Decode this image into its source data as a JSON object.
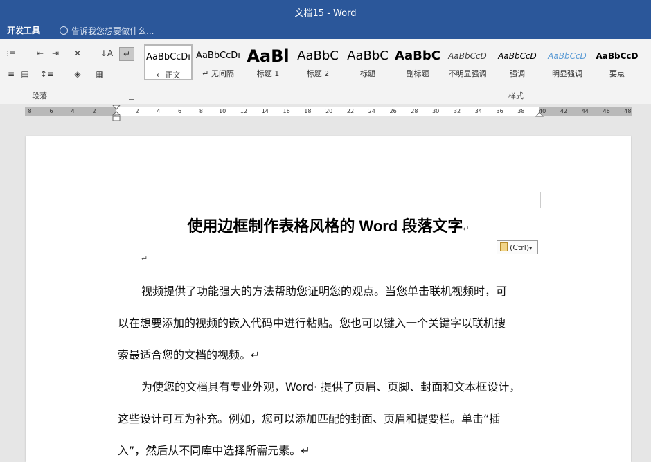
{
  "titlebar": {
    "title": "文档15 - Word"
  },
  "tabbar": {
    "tab": "开发工具",
    "tell_me": "告诉我您想要做什么..."
  },
  "ribbon": {
    "paragraph_label": "段落",
    "styles_label": "样式",
    "styles": [
      {
        "preview": "AaBbCcDı",
        "name": "↵ 正文",
        "size": 13,
        "weight": "normal",
        "italic": false,
        "color": "#000000"
      },
      {
        "preview": "AaBbCcDı",
        "name": "↵ 无间隔",
        "size": 13,
        "weight": "normal",
        "italic": false,
        "color": "#000000"
      },
      {
        "preview": "AaBl",
        "name": "标题 1",
        "size": 24,
        "weight": "bold",
        "italic": false,
        "color": "#000000"
      },
      {
        "preview": "AaBbC",
        "name": "标题 2",
        "size": 18,
        "weight": "normal",
        "italic": false,
        "color": "#000000"
      },
      {
        "preview": "AaBbC",
        "name": "标题",
        "size": 18,
        "weight": "normal",
        "italic": false,
        "color": "#000000"
      },
      {
        "preview": "AaBbC",
        "name": "副标题",
        "size": 18,
        "weight": "bold",
        "italic": false,
        "color": "#000000"
      },
      {
        "preview": "AaBbCcD",
        "name": "不明显强调",
        "size": 12,
        "weight": "normal",
        "italic": true,
        "color": "#404040"
      },
      {
        "preview": "AaBbCcD",
        "name": "强调",
        "size": 12,
        "weight": "normal",
        "italic": true,
        "color": "#000000"
      },
      {
        "preview": "AaBbCcD",
        "name": "明显强调",
        "size": 12,
        "weight": "normal",
        "italic": true,
        "color": "#5b9bd5"
      },
      {
        "preview": "AaBbCcD",
        "name": "要点",
        "size": 12,
        "weight": "bold",
        "italic": false,
        "color": "#000000"
      }
    ]
  },
  "ruler": {
    "left": [
      "8",
      "6",
      "4",
      "2"
    ],
    "right": [
      "2",
      "4",
      "6",
      "8",
      "10",
      "12",
      "14",
      "16",
      "18",
      "20",
      "22",
      "24",
      "26",
      "28",
      "30",
      "32",
      "34",
      "36",
      "38",
      "40",
      "42",
      "44",
      "46",
      "48"
    ]
  },
  "document": {
    "title": "使用边框制作表格风格的 Word 段落文字",
    "paste_label": "(Ctrl)",
    "para_mark": "↵",
    "lines": [
      "视频提供了功能强大的方法帮助您证明您的观点。当您单击联机视频时，可",
      "以在想要添加的视频的嵌入代码中进行粘贴。您也可以键入一个关键字以联机搜",
      "索最适合您的文档的视频。↵",
      "为使您的文档具有专业外观，Word· 提供了页眉、页脚、封面和文本框设计，",
      "这些设计可互为补充。例如，您可以添加匹配的封面、页眉和提要栏。单击“插",
      "入”，然后从不同库中选择所需元素。↵"
    ]
  }
}
